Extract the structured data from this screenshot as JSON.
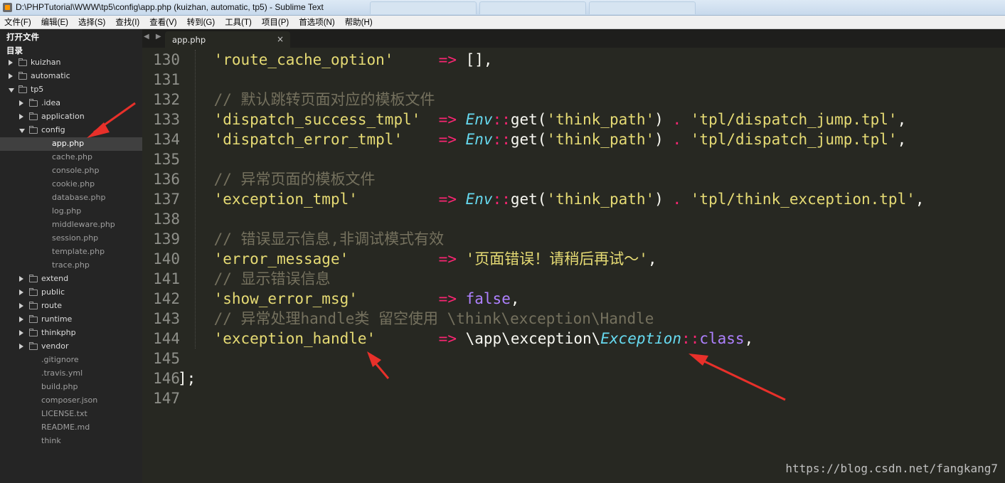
{
  "window": {
    "title": "D:\\PHPTutorial\\WWW\\tp5\\config\\app.php (kuizhan, automatic, tp5) - Sublime Text"
  },
  "menu": [
    "文件(F)",
    "编辑(E)",
    "选择(S)",
    "查找(I)",
    "查看(V)",
    "转到(G)",
    "工具(T)",
    "项目(P)",
    "首选项(N)",
    "帮助(H)"
  ],
  "sidebar": {
    "open_files_label": "打开文件",
    "folders_label": "目录",
    "tree": [
      {
        "label": "kuizhan",
        "type": "folder",
        "depth": 0,
        "expanded": false
      },
      {
        "label": "automatic",
        "type": "folder",
        "depth": 0,
        "expanded": false
      },
      {
        "label": "tp5",
        "type": "folder",
        "depth": 0,
        "expanded": true
      },
      {
        "label": ".idea",
        "type": "folder",
        "depth": 1,
        "expanded": false
      },
      {
        "label": "application",
        "type": "folder",
        "depth": 1,
        "expanded": false
      },
      {
        "label": "config",
        "type": "folder",
        "depth": 1,
        "expanded": true
      },
      {
        "label": "app.php",
        "type": "file",
        "depth": 2,
        "selected": true
      },
      {
        "label": "cache.php",
        "type": "file",
        "depth": 2
      },
      {
        "label": "console.php",
        "type": "file",
        "depth": 2
      },
      {
        "label": "cookie.php",
        "type": "file",
        "depth": 2
      },
      {
        "label": "database.php",
        "type": "file",
        "depth": 2
      },
      {
        "label": "log.php",
        "type": "file",
        "depth": 2
      },
      {
        "label": "middleware.php",
        "type": "file",
        "depth": 2
      },
      {
        "label": "session.php",
        "type": "file",
        "depth": 2
      },
      {
        "label": "template.php",
        "type": "file",
        "depth": 2
      },
      {
        "label": "trace.php",
        "type": "file",
        "depth": 2
      },
      {
        "label": "extend",
        "type": "folder",
        "depth": 1,
        "expanded": false
      },
      {
        "label": "public",
        "type": "folder",
        "depth": 1,
        "expanded": false
      },
      {
        "label": "route",
        "type": "folder",
        "depth": 1,
        "expanded": false
      },
      {
        "label": "runtime",
        "type": "folder",
        "depth": 1,
        "expanded": false
      },
      {
        "label": "thinkphp",
        "type": "folder",
        "depth": 1,
        "expanded": false
      },
      {
        "label": "vendor",
        "type": "folder",
        "depth": 1,
        "expanded": false
      },
      {
        "label": ".gitignore",
        "type": "file",
        "depth": 1
      },
      {
        "label": ".travis.yml",
        "type": "file",
        "depth": 1
      },
      {
        "label": "build.php",
        "type": "file",
        "depth": 1
      },
      {
        "label": "composer.json",
        "type": "file",
        "depth": 1
      },
      {
        "label": "LICENSE.txt",
        "type": "file",
        "depth": 1
      },
      {
        "label": "README.md",
        "type": "file",
        "depth": 1
      },
      {
        "label": "think",
        "type": "file",
        "depth": 1
      }
    ]
  },
  "tabbar": {
    "nav": "◀ ▶",
    "active_tab": {
      "label": "app.php",
      "close": "×"
    }
  },
  "editor": {
    "lines": [
      {
        "num": "130",
        "tokens": [
          [
            "pl",
            "    "
          ],
          [
            "str",
            "'route_cache_option'"
          ],
          [
            "pl",
            "     "
          ],
          [
            "op",
            "=>"
          ],
          [
            "pl",
            " [],"
          ]
        ]
      },
      {
        "num": "131",
        "tokens": []
      },
      {
        "num": "132",
        "tokens": [
          [
            "pl",
            "    "
          ],
          [
            "cmt",
            "// 默认跳转页面对应的模板文件"
          ]
        ]
      },
      {
        "num": "133",
        "tokens": [
          [
            "pl",
            "    "
          ],
          [
            "str",
            "'dispatch_success_tmpl'"
          ],
          [
            "pl",
            "  "
          ],
          [
            "op",
            "=>"
          ],
          [
            "pl",
            " "
          ],
          [
            "cls",
            "Env"
          ],
          [
            "op",
            "::"
          ],
          [
            "fn",
            "get"
          ],
          [
            "pl",
            "("
          ],
          [
            "str",
            "'think_path'"
          ],
          [
            "pl",
            ") "
          ],
          [
            "op",
            "."
          ],
          [
            "pl",
            " "
          ],
          [
            "str",
            "'tpl/dispatch_jump.tpl'"
          ],
          [
            "pl",
            ","
          ]
        ]
      },
      {
        "num": "134",
        "tokens": [
          [
            "pl",
            "    "
          ],
          [
            "str",
            "'dispatch_error_tmpl'"
          ],
          [
            "pl",
            "    "
          ],
          [
            "op",
            "=>"
          ],
          [
            "pl",
            " "
          ],
          [
            "cls",
            "Env"
          ],
          [
            "op",
            "::"
          ],
          [
            "fn",
            "get"
          ],
          [
            "pl",
            "("
          ],
          [
            "str",
            "'think_path'"
          ],
          [
            "pl",
            ") "
          ],
          [
            "op",
            "."
          ],
          [
            "pl",
            " "
          ],
          [
            "str",
            "'tpl/dispatch_jump.tpl'"
          ],
          [
            "pl",
            ","
          ]
        ]
      },
      {
        "num": "135",
        "tokens": []
      },
      {
        "num": "136",
        "tokens": [
          [
            "pl",
            "    "
          ],
          [
            "cmt",
            "// 异常页面的模板文件"
          ]
        ]
      },
      {
        "num": "137",
        "tokens": [
          [
            "pl",
            "    "
          ],
          [
            "str",
            "'exception_tmpl'"
          ],
          [
            "pl",
            "         "
          ],
          [
            "op",
            "=>"
          ],
          [
            "pl",
            " "
          ],
          [
            "cls",
            "Env"
          ],
          [
            "op",
            "::"
          ],
          [
            "fn",
            "get"
          ],
          [
            "pl",
            "("
          ],
          [
            "str",
            "'think_path'"
          ],
          [
            "pl",
            ") "
          ],
          [
            "op",
            "."
          ],
          [
            "pl",
            " "
          ],
          [
            "str",
            "'tpl/think_exception.tpl'"
          ],
          [
            "pl",
            ","
          ]
        ]
      },
      {
        "num": "138",
        "tokens": []
      },
      {
        "num": "139",
        "tokens": [
          [
            "pl",
            "    "
          ],
          [
            "cmt",
            "// 错误显示信息,非调试模式有效"
          ]
        ]
      },
      {
        "num": "140",
        "tokens": [
          [
            "pl",
            "    "
          ],
          [
            "str",
            "'error_message'"
          ],
          [
            "pl",
            "          "
          ],
          [
            "op",
            "=>"
          ],
          [
            "pl",
            " "
          ],
          [
            "str",
            "'页面错误！请稍后再试～'"
          ],
          [
            "pl",
            ","
          ]
        ]
      },
      {
        "num": "141",
        "tokens": [
          [
            "pl",
            "    "
          ],
          [
            "cmt",
            "// 显示错误信息"
          ]
        ]
      },
      {
        "num": "142",
        "tokens": [
          [
            "pl",
            "    "
          ],
          [
            "str",
            "'show_error_msg'"
          ],
          [
            "pl",
            "         "
          ],
          [
            "op",
            "=>"
          ],
          [
            "pl",
            " "
          ],
          [
            "kw",
            "false"
          ],
          [
            "pl",
            ","
          ]
        ]
      },
      {
        "num": "143",
        "tokens": [
          [
            "pl",
            "    "
          ],
          [
            "cmt",
            "// 异常处理handle类 留空使用 \\think\\exception\\Handle"
          ]
        ]
      },
      {
        "num": "144",
        "tokens": [
          [
            "pl",
            "    "
          ],
          [
            "str",
            "'exception_handle'"
          ],
          [
            "pl",
            "       "
          ],
          [
            "op",
            "=>"
          ],
          [
            "pl",
            " \\app\\exception\\"
          ],
          [
            "cls",
            "Exception"
          ],
          [
            "op",
            "::"
          ],
          [
            "kw",
            "class"
          ],
          [
            "pl",
            ","
          ]
        ]
      },
      {
        "num": "145",
        "tokens": []
      },
      {
        "num": "146",
        "tokens": [
          [
            "pl",
            "];"
          ]
        ]
      },
      {
        "num": "147",
        "tokens": []
      }
    ]
  },
  "watermark": "https://blog.csdn.net/fangkang7"
}
